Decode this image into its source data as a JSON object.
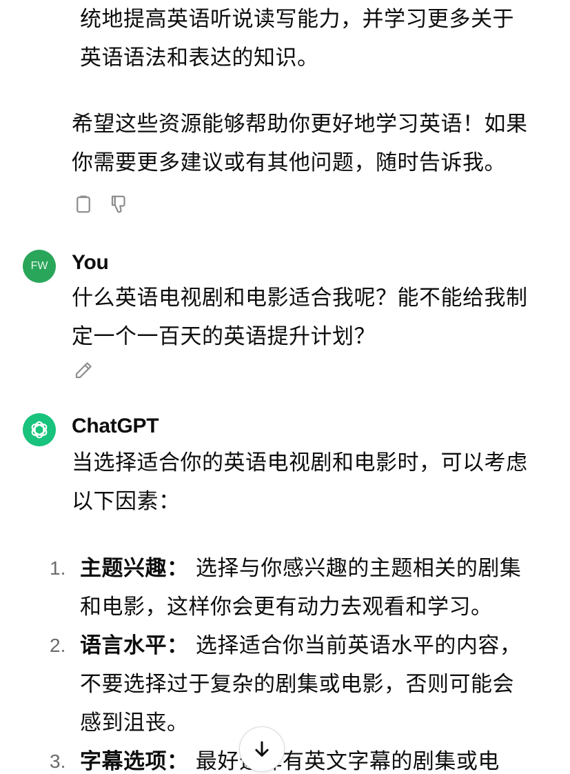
{
  "previous_message": {
    "block_lines": [
      "统地提高英语听说读写能力，并学习更多关于",
      "英语语法和表达的知识。"
    ],
    "closing_lines": [
      "希望这些资源能够帮助你更好地学习英语！如果",
      "你需要更多建议或有其他问题，随时告诉我。"
    ],
    "actions": [
      "copy-icon",
      "thumbs-down-icon"
    ]
  },
  "user_message": {
    "avatar_initials": "FW",
    "sender": "You",
    "lines": [
      "什么英语电视剧和电影适合我呢？能不能给我制",
      "定一个一百天的英语提升计划？"
    ],
    "actions": [
      "edit-icon"
    ]
  },
  "assistant_message": {
    "sender": "ChatGPT",
    "intro_lines": [
      "当选择适合你的英语电视剧和电影时，可以考虑",
      "以下因素："
    ],
    "list": [
      {
        "number": "1.",
        "title": "主题兴趣：",
        "first_line_rest": " 选择与你感兴趣的主题相关的剧集",
        "more_lines": [
          "和电影，这样你会更有动力去观看和学习。"
        ]
      },
      {
        "number": "2.",
        "title": "语言水平：",
        "first_line_rest": " 选择适合你当前英语水平的内容，",
        "more_lines": [
          "不要选择过于复杂的剧集或电影，否则可能会",
          "感到沮丧。"
        ]
      },
      {
        "number": "3.",
        "title": "字幕选项：",
        "first_line_rest": " 最好选择有英文字幕的剧集或电",
        "more_lines": []
      }
    ]
  },
  "scroll_button": {
    "icon": "arrow-down-icon"
  }
}
